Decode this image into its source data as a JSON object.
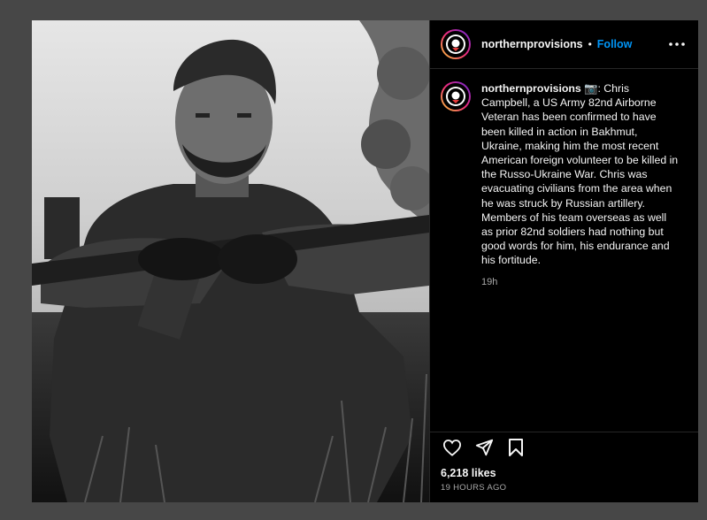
{
  "post": {
    "username": "northernprovisions",
    "follow_label": "Follow",
    "separator": "•",
    "caption_username": "northernprovisions",
    "caption_text": " 📷: Chris Campbell, a US Army 82nd Airborne Veteran has been confirmed to have been killed in action in Bakhmut, Ukraine, making him the most recent American foreign volunteer to be killed in the Russo-Ukraine War. Chris was evacuating civilians from the area when he was struck by Russian artillery. Members of his team overseas as well as prior 82nd soldiers had nothing but good words for him, his endurance and his fortitude.",
    "caption_time": "19h",
    "likes": "6,218 likes",
    "posted_ago": "19 HOURS AGO"
  },
  "icons": {
    "more": "more-options-icon",
    "like": "heart-icon",
    "share": "paper-plane-icon",
    "save": "bookmark-icon"
  },
  "colors": {
    "follow": "#0095f6",
    "background": "#000000",
    "muted_text": "#a8a8a8"
  }
}
